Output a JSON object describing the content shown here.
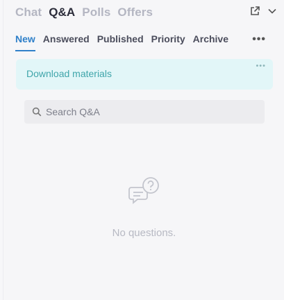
{
  "header": {
    "tabs": [
      {
        "label": "Chat",
        "active": false
      },
      {
        "label": "Q&A",
        "active": true
      },
      {
        "label": "Polls",
        "active": false
      },
      {
        "label": "Offers",
        "active": false
      }
    ],
    "icons": [
      "popout-icon",
      "chevron-down-icon"
    ]
  },
  "subtabs": [
    {
      "label": "New",
      "active": true
    },
    {
      "label": "Answered",
      "active": false
    },
    {
      "label": "Published",
      "active": false
    },
    {
      "label": "Priority",
      "active": false
    },
    {
      "label": "Archive",
      "active": false
    }
  ],
  "more_label": "•••",
  "download": {
    "label": "Download materials",
    "more": "•••"
  },
  "search": {
    "placeholder": "Search Q&A",
    "value": ""
  },
  "empty": {
    "text": "No questions.",
    "icon": "question-bubbles-icon"
  },
  "colors": {
    "accent": "#2f80c9",
    "download_bg": "#e2f6f8",
    "download_text": "#3fa5aa"
  }
}
